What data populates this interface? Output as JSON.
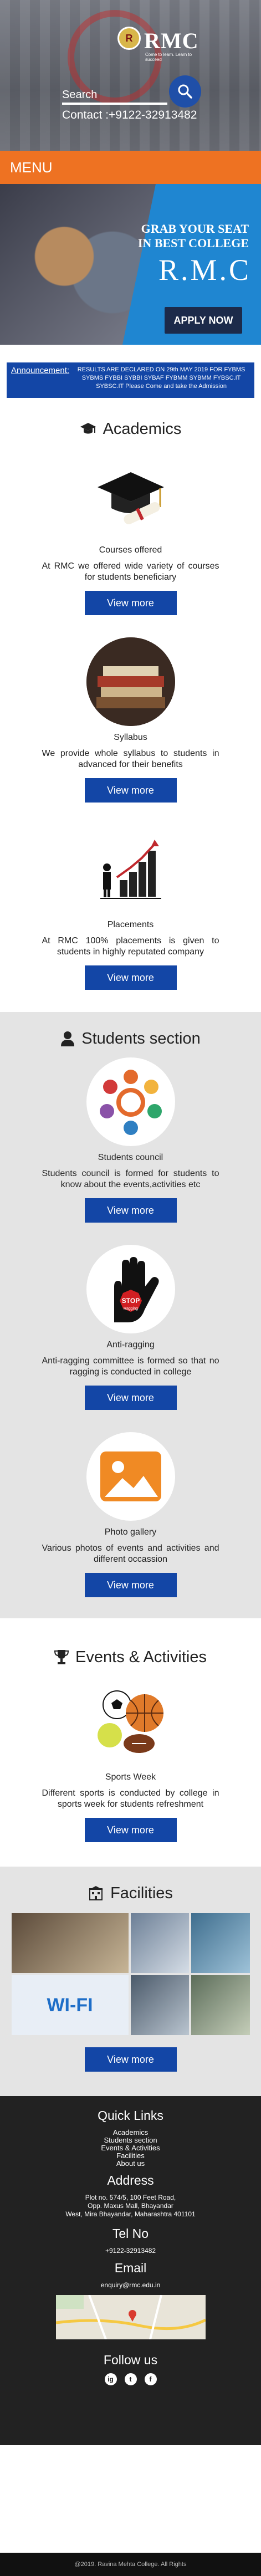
{
  "header": {
    "logo_text": "RMC",
    "logo_badge": "R",
    "logo_tagline": "Come to learn. Learn to succeed",
    "search_label": "Search",
    "contact": "Contact :+9122-32913482"
  },
  "menu": {
    "label": "MENU"
  },
  "hero": {
    "line1": "GRAB YOUR SEAT",
    "line2": "IN BEST COLLEGE",
    "brand": "R.M.C",
    "apply": "APPLY NOW"
  },
  "announcement": {
    "label": "Announcement:",
    "text": "RESULTS ARE DECLARED ON 29th MAY 2019 FOR FYBMS SYBMS FYBBI SYBBI SYBAF FYBMM SYBMM FYBSC.IT SYBSC.IT Please Come and take the Admission"
  },
  "academics": {
    "title": "Academics",
    "cards": [
      {
        "label": "Courses offered",
        "text": "At RMC we offered wide variety of courses for students beneficiary",
        "button": "View more"
      },
      {
        "label": "Syllabus",
        "text": "We provide whole syllabus to students in advanced for their benefits",
        "button": "View more"
      },
      {
        "label": "Placements",
        "text": "At RMC 100% placements is given to students in highly reputated company",
        "button": "View more"
      }
    ]
  },
  "students": {
    "title": "Students section",
    "cards": [
      {
        "label": "Students council",
        "text": "Students council is formed for students to know about the events,activities etc",
        "button": "View more"
      },
      {
        "label": "Anti-ragging",
        "text": "Anti-ragging committee is formed so that no ragging is conducted in college",
        "button": "View more",
        "stop_text": "STOP",
        "stop_sub": "Ragging"
      },
      {
        "label": "Photo gallery",
        "text": "Various photos of events and activities and different occassion",
        "button": "View more"
      }
    ]
  },
  "events": {
    "title": "Events & Activities",
    "cards": [
      {
        "label": "Sports Week",
        "text": "Different sports is conducted by college in sports week for students refreshment",
        "button": "View more"
      }
    ]
  },
  "facilities": {
    "title": "Facilities",
    "wifi_text": "WI-FI",
    "button": "View more"
  },
  "footer": {
    "quick_links_title": "Quick Links",
    "quick_links": [
      "Academics",
      "Students section",
      "Events & Activities",
      "Facilities",
      "About us"
    ],
    "address_title": "Address",
    "address": [
      "Plot no. 574/5, 100 Feet Road,",
      "Opp. Maxus Mall, Bhayandar",
      "West, Mira Bhayandar, Maharashtra 401101"
    ],
    "tel_title": "Tel No",
    "tel": "+9122-32913482",
    "email_title": "Email",
    "email": "enquiry@rmc.edu.in",
    "follow_title": "Follow us",
    "socials": [
      "ig",
      "t",
      "f"
    ],
    "copyright": "@2019. Ravina Mehta College. All Rights"
  },
  "colors": {
    "orange": "#ee7222",
    "blue": "#1346a6",
    "hero_blue": "#1f86d1",
    "footer": "#222222"
  }
}
